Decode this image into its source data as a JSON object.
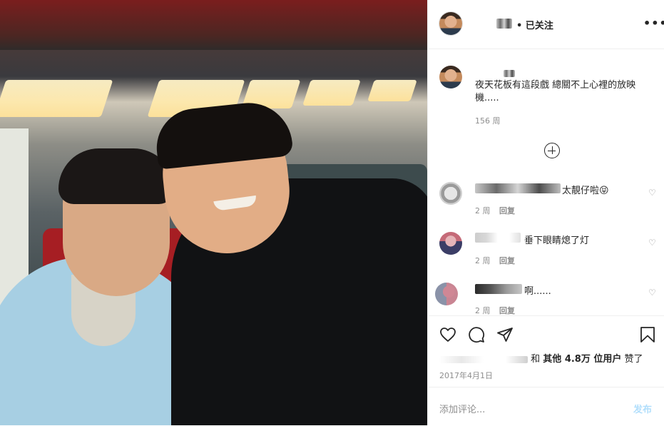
{
  "header": {
    "follow_label": "• 已关注",
    "more_label": "•••"
  },
  "caption": {
    "text": "夜天花板有這段戲 總關不上心裡的放映機.....",
    "time": "156 周"
  },
  "comments": [
    {
      "text": "太靚仔啦😝",
      "time": "2 周",
      "reply": "回复"
    },
    {
      "text": "垂下眼睛熄了灯",
      "time": "2 周",
      "reply": "回复"
    },
    {
      "text": "啊......",
      "time": "2 周",
      "reply": "回复"
    }
  ],
  "likes": {
    "prefix": "和",
    "count": "其他 4.8万 位用户",
    "suffix": "赞了"
  },
  "date": "2017年4月1日",
  "add_comment": {
    "placeholder": "添加评论...",
    "post_label": "发布"
  },
  "colors": {
    "post_disabled": "#b2dffc",
    "meta_gray": "#8e8e8e",
    "text": "#262626"
  },
  "icons": [
    "heart-icon",
    "comment-icon",
    "share-icon",
    "bookmark-icon",
    "add-circle-icon",
    "more-icon"
  ]
}
